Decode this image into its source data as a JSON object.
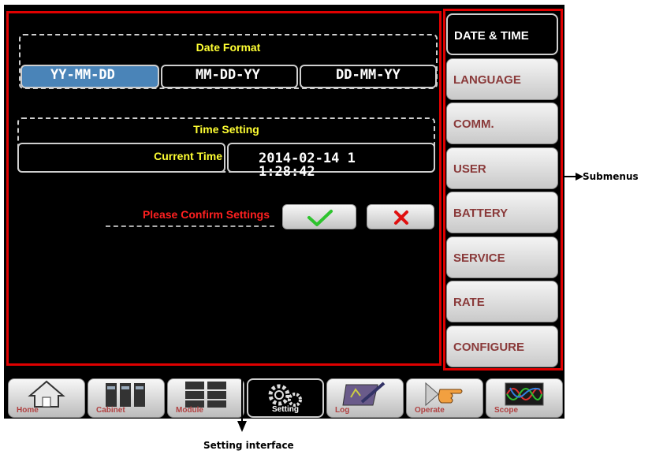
{
  "date_format": {
    "title": "Date Format",
    "options": [
      "YY-MM-DD",
      "MM-DD-YY",
      "DD-MM-YY"
    ],
    "selected": "YY-MM-DD"
  },
  "time_setting": {
    "title": "Time Setting",
    "current_time_label": "Current Time",
    "current_time_value": "2014-02-14 11:28:42"
  },
  "confirm": {
    "prompt": "Please Confirm Settings",
    "ok_icon": "checkmark-icon",
    "cancel_icon": "x-icon"
  },
  "submenus": [
    {
      "label": "DATE & TIME",
      "active": true
    },
    {
      "label": "LANGUAGE",
      "active": false
    },
    {
      "label": "COMM.",
      "active": false
    },
    {
      "label": "USER",
      "active": false
    },
    {
      "label": "BATTERY",
      "active": false
    },
    {
      "label": "SERVICE",
      "active": false
    },
    {
      "label": "RATE",
      "active": false
    },
    {
      "label": "CONFIGURE",
      "active": false
    }
  ],
  "bottom_tabs": [
    {
      "label": "Home",
      "icon": "home-icon",
      "active": false
    },
    {
      "label": "Cabinet",
      "icon": "cabinet-icon",
      "active": false
    },
    {
      "label": "Module",
      "icon": "module-icon",
      "active": false
    },
    {
      "label": "Setting",
      "icon": "gears-icon",
      "active": true
    },
    {
      "label": "Log",
      "icon": "log-icon",
      "active": false
    },
    {
      "label": "Operate",
      "icon": "hand-pointer-icon",
      "active": false
    },
    {
      "label": "Scope",
      "icon": "waveform-icon",
      "active": false
    }
  ],
  "annotations": {
    "submenus": "Submenus",
    "setting_interface": "Setting interface"
  },
  "colors": {
    "highlight_red": "#e00000",
    "title_yellow": "#ffff33",
    "selected_blue": "#4a84b8",
    "menu_text": "#8a3a3a"
  }
}
